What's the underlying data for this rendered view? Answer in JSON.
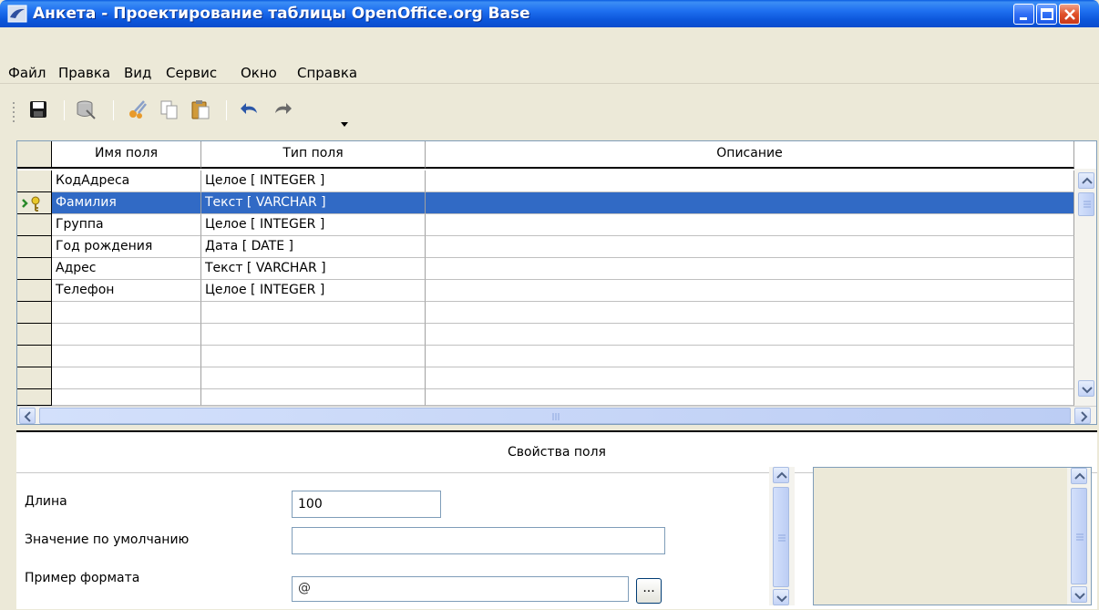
{
  "window": {
    "title": "Анкета - Проектирование таблицы OpenOffice.org Base"
  },
  "menu": [
    "Файл",
    "Правка",
    "Вид",
    "Сервис",
    "Окно",
    "Справка"
  ],
  "toolbar": {
    "icons": [
      "save-icon",
      "database-icon",
      "cut-icon",
      "copy-icon",
      "paste-icon",
      "undo-icon",
      "redo-icon",
      "dropdown-arrow-icon"
    ]
  },
  "grid": {
    "headers": {
      "name": "Имя поля",
      "type": "Тип поля",
      "description": "Описание"
    },
    "rows": [
      {
        "name": "КодАдреса",
        "type": "Целое [ INTEGER ]",
        "description": ""
      },
      {
        "name": "Фамилия",
        "type": "Текст [ VARCHAR ]",
        "description": "",
        "selected": true,
        "primary_key": true
      },
      {
        "name": "Группа",
        "type": "Целое [ INTEGER ]",
        "description": ""
      },
      {
        "name": "Год рождения",
        "type": "Дата [ DATE ]",
        "description": ""
      },
      {
        "name": "Адрес",
        "type": "Текст [ VARCHAR ]",
        "description": ""
      },
      {
        "name": "Телефон",
        "type": "Целое [ INTEGER ]",
        "description": ""
      }
    ],
    "empty_rows": 4
  },
  "properties": {
    "title": "Свойства поля",
    "length_label": "Длина",
    "length_value": "100",
    "default_label": "Значение по умолчанию",
    "default_value": "",
    "format_label": "Пример формата",
    "format_value": "@",
    "format_button": "..."
  },
  "colors": {
    "titlebar": "#0a5be0",
    "selection": "#316ac5",
    "window_bg": "#ece9d8"
  }
}
